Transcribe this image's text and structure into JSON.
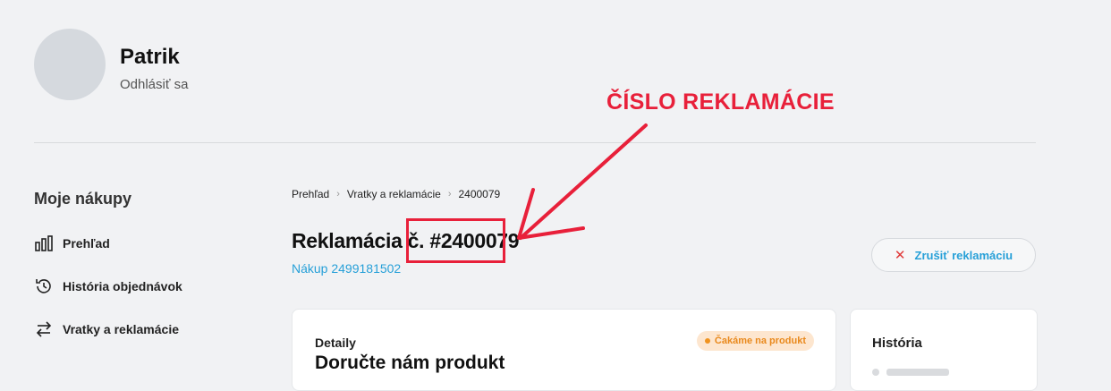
{
  "user": {
    "name": "Patrik",
    "logout_label": "Odhlásiť sa"
  },
  "sidebar": {
    "title": "Moje nákupy",
    "items": [
      {
        "label": "Prehľad",
        "icon": "chart-bars-icon"
      },
      {
        "label": "História objednávok",
        "icon": "history-icon"
      },
      {
        "label": "Vratky a reklamácie",
        "icon": "swap-arrows-icon"
      }
    ]
  },
  "breadcrumb": [
    "Prehľad",
    "Vratky a reklamácie",
    "2400079"
  ],
  "page": {
    "title_prefix": "Reklamácia č.",
    "claim_number": "#2400079",
    "purchase_link": "Nákup 2499181502",
    "cancel_label": "Zrušiť reklamáciu"
  },
  "detail": {
    "label": "Detaily",
    "title": "Doručte nám produkt",
    "status": "Čakáme na produkt"
  },
  "history": {
    "title": "História"
  },
  "annotation": {
    "text": "ČÍSLO REKLAMÁCIE",
    "color": "#e8203a"
  },
  "colors": {
    "accent": "#27a0d8",
    "status": "#e9891c",
    "annotation": "#e8203a"
  }
}
